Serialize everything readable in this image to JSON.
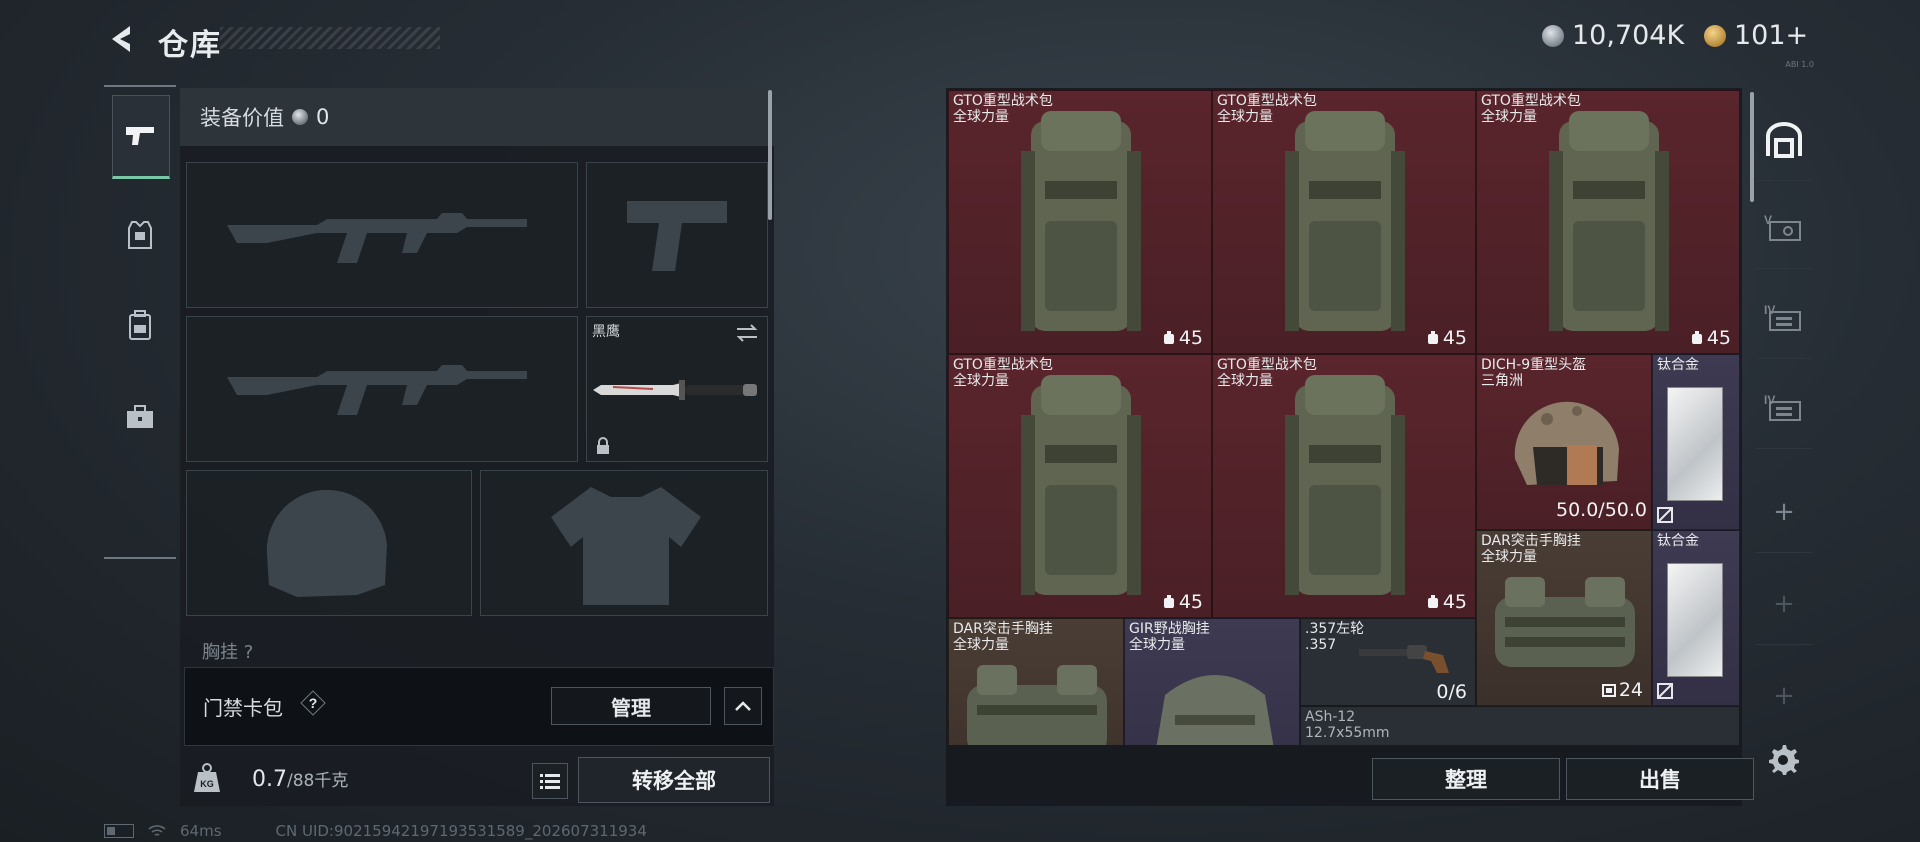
{
  "header": {
    "title": "仓库",
    "silver_amount": "10,704K",
    "gold_amount": "101+",
    "version_tag": "ABI 1.0"
  },
  "left_tabs": [
    {
      "name": "weapons-tab",
      "icon": "pistol-icon",
      "active": true
    },
    {
      "name": "armor-tab",
      "icon": "vest-icon",
      "active": false
    },
    {
      "name": "backpack-tab",
      "icon": "backpack-icon",
      "active": false
    },
    {
      "name": "case-tab",
      "icon": "briefcase-icon",
      "active": false
    }
  ],
  "equipment": {
    "value_label": "装备价值",
    "value": "0",
    "knife_name": "黑鹰",
    "next_section_label": "胸挂 ?"
  },
  "card_bag": {
    "label": "门禁卡包",
    "help": "?",
    "manage": "管理"
  },
  "footer_left": {
    "weight_current": "0.7",
    "weight_max": "/88千克",
    "transfer_all": "转移全部"
  },
  "status_bar": {
    "ping": "64ms",
    "uid": "CN UID:9021594219719353158​9_202607311934"
  },
  "stash": {
    "items": [
      {
        "name": "GTO重型战术包",
        "sub": "全球力量",
        "count": "45",
        "rarity": "red"
      },
      {
        "name": "GTO重型战术包",
        "sub": "全球力量",
        "count": "45",
        "rarity": "red"
      },
      {
        "name": "GTO重型战术包",
        "sub": "全球力量",
        "count": "45",
        "rarity": "red"
      },
      {
        "name": "GTO重型战术包",
        "sub": "全球力量",
        "count": "45",
        "rarity": "red"
      },
      {
        "name": "GTO重型战术包",
        "sub": "全球力量",
        "count": "45",
        "rarity": "red"
      },
      {
        "name": "DICH-9重型头盔",
        "sub": "三角洲",
        "count": "50.0/50.0",
        "rarity": "red"
      },
      {
        "name": "钛合金",
        "sub": "",
        "count": "",
        "rarity": "purple"
      },
      {
        "name": "DAR突击手胸挂",
        "sub": "全球力量",
        "count": "24",
        "rarity": "brown"
      },
      {
        "name": "钛合金",
        "sub": "",
        "count": "",
        "rarity": "purple"
      },
      {
        "name": "DAR突击手胸挂",
        "sub": "全球力量",
        "count": "",
        "rarity": "brown"
      },
      {
        "name": "GIR野战胸挂",
        "sub": "全球力量",
        "count": "",
        "rarity": "purple"
      },
      {
        "name": ".357左轮",
        "sub": ".357",
        "count": "0/6",
        "rarity": "dark"
      },
      {
        "name": "ASh-12",
        "sub": "12.7x55mm",
        "count": "",
        "rarity": "dark"
      }
    ],
    "sort": "整理",
    "sell": "出售"
  },
  "side_tabs": [
    "stash-icon",
    "container-v-icon",
    "container-iv-icon",
    "container-iv-icon",
    "add-icon",
    "add-icon",
    "add-icon"
  ],
  "colors": {
    "accent": "#79c7a6",
    "rarity_red": "#5a252c",
    "rarity_brown": "#4a3d35",
    "rarity_purple": "#3e3a52"
  }
}
